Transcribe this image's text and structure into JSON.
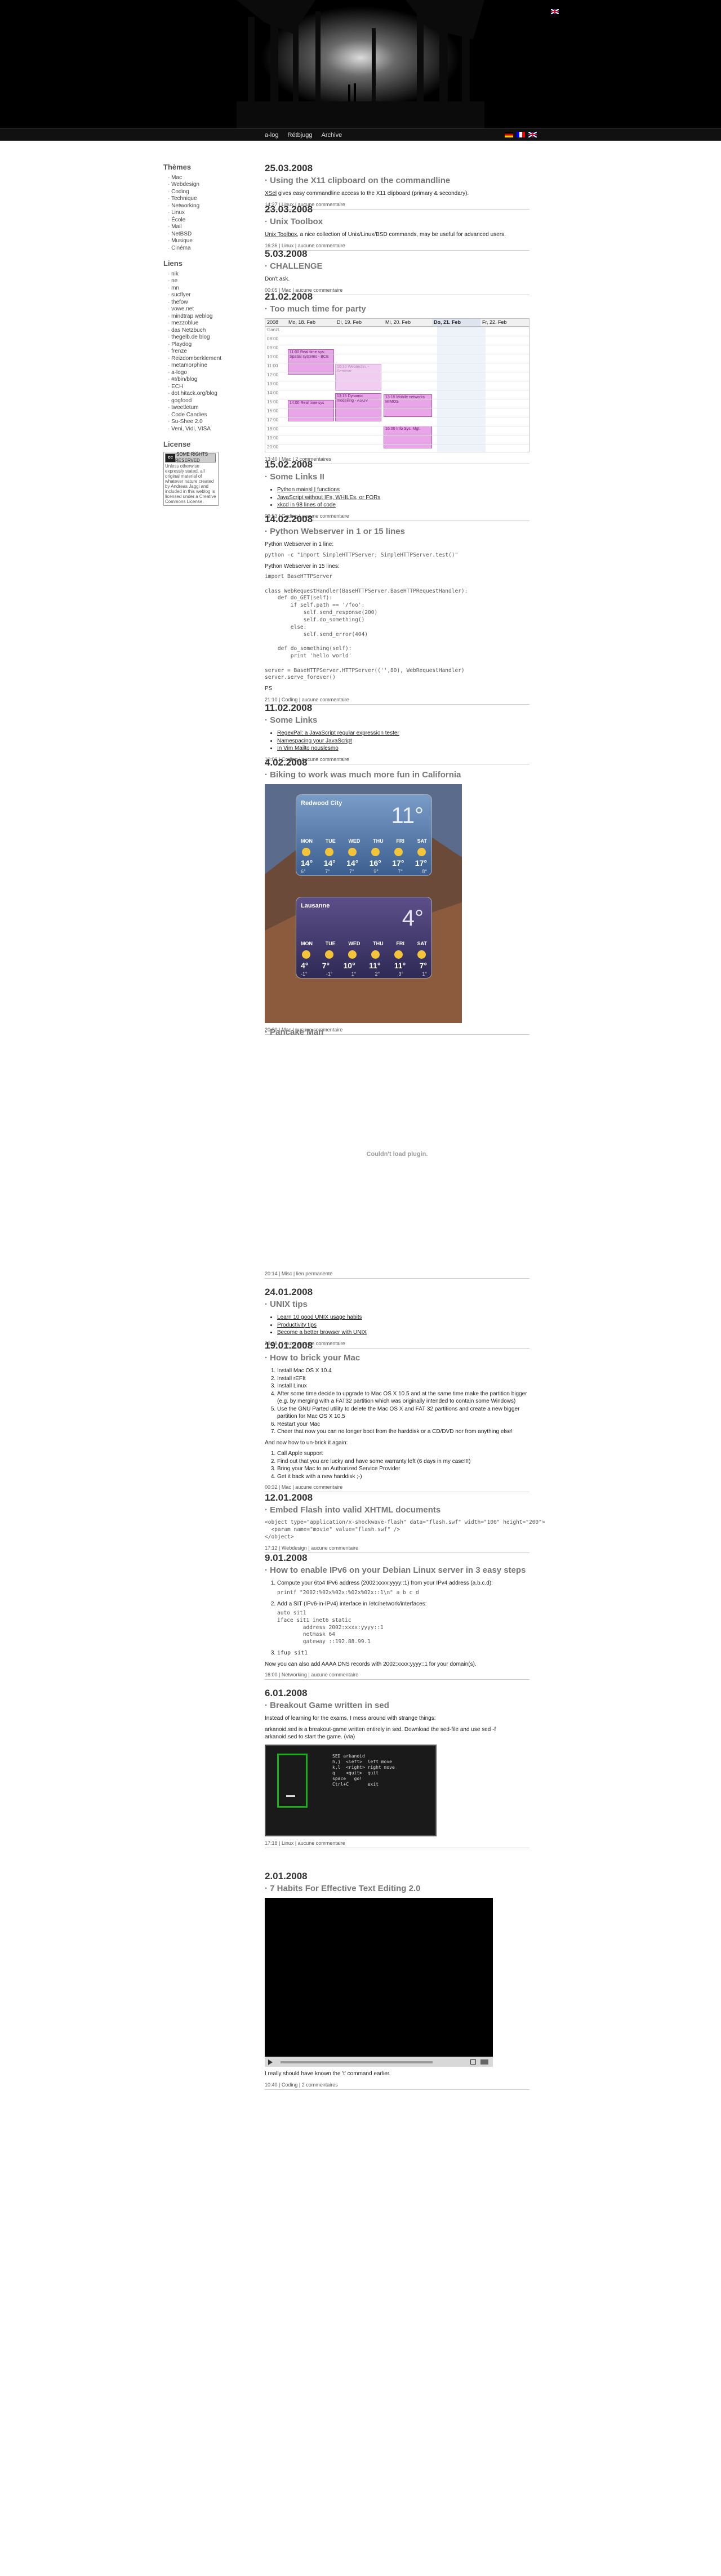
{
  "header": {
    "nav_links": [
      "a-log",
      "Rétbjugg",
      "Archive"
    ]
  },
  "sidebar": {
    "themes_heading": "Thèmes",
    "themes": [
      "Mac",
      "Webdesign",
      "Coding",
      "Technique",
      "Networking",
      "Linux",
      "École",
      "Mail",
      "NetBSD",
      "Musique",
      "Cinéma"
    ],
    "links_heading": "Liens",
    "links": [
      "nik",
      "ne",
      "mn",
      "sucflyer",
      "thefow",
      "vowe.net",
      "mindtrap weblog",
      "mezzoblue",
      "das Netzbuch",
      "thegelb.de blog",
      "Playdog",
      "frenze",
      "Reizdomberklement",
      "metamorphine",
      "a-logo",
      "#!/bin/blog",
      "ECH",
      "dot.hitack.org/blog",
      "gogfood",
      "tweetletum",
      "Code Candies",
      "Su-Shee 2.0",
      "Veni, Vidi, VISA"
    ],
    "license_heading": "License",
    "license_text": "Unless otherwise expressly stated, all original material of whatever nature created by Andreas Jaggi and included in this weblog is licensed under a Creative Commons License."
  },
  "posts": {
    "p1": {
      "date": "25.03.2008",
      "title": "Using the X11 clipboard on the commandline",
      "link": "XSel",
      "body": " gives easy commandline access to the X11 clipboard (primary & secondary).",
      "time": "14:27",
      "category": "Linux",
      "comments": "aucune commentaire"
    },
    "p2": {
      "date": "23.03.2008",
      "title": "Unix Toolbox",
      "link": "Unix Toolbox",
      "body": ", a nice collection of Unix/Linux/BSD commands, may be useful for advanced users.",
      "time": "16:36",
      "category": "Linux",
      "comments": "aucune commentaire"
    },
    "p3": {
      "date": "5.03.2008",
      "title": "CHALLENGE",
      "body": "Don't ask.",
      "time": "00:05",
      "category": "Mac",
      "comments": "aucune commentaire"
    },
    "p4": {
      "date": "21.02.2008",
      "title": "Too much time for party",
      "time": "13:40",
      "category": "Mac",
      "comments": "2 commentaires",
      "cal_year": "2008",
      "cal_days": [
        "Mo, 18. Feb",
        "Di, 19. Feb",
        "Mi, 20. Feb",
        "Do, 21. Feb",
        "Fr, 22. Feb"
      ],
      "cal_hours": [
        "Ganzt.",
        "08:00",
        "09:00",
        "10:00",
        "11:00",
        "12:00",
        "13:00",
        "14:00",
        "15:00",
        "16:00",
        "17:00",
        "18:00",
        "19:00",
        "20:00"
      ],
      "events": [
        "11:00 Real time sys: Spatial systems - BCE",
        "14:00 Real time sys",
        "13:15 Dynamic modelling - ASOV",
        "10:30 Webtechn. - Seminar ...",
        "13:15 Mobile networks MIMOS",
        "16:00 Info Sys. Mgt."
      ]
    },
    "p5": {
      "date": "15.02.2008",
      "title": "Some Links II",
      "items": [
        "Python mainsl | functions",
        "JavaScript without IFs, WHILEs, or FORs",
        "xkcd in 98 lines of code"
      ],
      "time": "09:53",
      "category": "Coding",
      "comments": "aucune commentaire"
    },
    "p6": {
      "date": "14.02.2008",
      "title": "Python Webserver in 1 or 15 lines",
      "intro1": "Python Webserver in 1 line:",
      "code1": "python -c \"import SimpleHTTPServer; SimpleHTTPServer.test()\"",
      "intro2": "Python Webserver in 15 lines:",
      "code2": "import BaseHTTPServer\n\nclass WebRequestHandler(BaseHTTPServer.BaseHTTPRequestHandler):\n    def do_GET(self):\n        if self.path == '/foo':\n            self.send_response(200)\n            self.do_something()\n        else:\n            self.send_error(404)\n\n    def do_something(self):\n        print 'hello world'\n\nserver = BaseHTTPServer.HTTPServer(('',80), WebRequestHandler)\nserver.serve_forever()",
      "outro": "PS",
      "time": "21:10",
      "category": "Coding",
      "comments": "aucune commentaire"
    },
    "p7": {
      "date": "11.02.2008",
      "title": "Some Links",
      "items": [
        "RegexPal: a JavaScript regular expression tester",
        "Namespacing your JavaScript",
        "In Vim Mailto nouslesmo"
      ],
      "time": "10:00",
      "category": "Coding",
      "comments": "aucune commentaire"
    },
    "p8": {
      "date": "4.02.2008",
      "title": "Biking to work was much more fun in California",
      "w1_city": "Redwood City",
      "w1_temp": "11°",
      "w2_city": "Lausanne",
      "w2_temp": "4°",
      "days": [
        "MON",
        "TUE",
        "WED",
        "THU",
        "FRI",
        "SAT"
      ],
      "w1_hi": [
        "14°",
        "14°",
        "14°",
        "16°",
        "17°",
        "17°"
      ],
      "w1_lo": [
        "6°",
        "7°",
        "7°",
        "9°",
        "7°",
        "8°"
      ],
      "w2_hi": [
        "4°",
        "7°",
        "10°",
        "11°",
        "11°",
        "7°"
      ],
      "w2_lo": [
        "-1°",
        "-1°",
        "1°",
        "2°",
        "3°",
        "1°"
      ],
      "time": "20:30",
      "category": "Mac",
      "comments": "aucune commentaire"
    },
    "p9": {
      "title": "Pancake Man",
      "plugin": "Couldn't load plugin.",
      "time": "20:14",
      "category": "Misc",
      "comments": "lien permanente"
    },
    "p10": {
      "date": "24.01.2008",
      "title": "UNIX tips",
      "items": [
        "Learn 10 good UNIX usage habits",
        "Productivity tips",
        "Become a better browser with UNIX"
      ],
      "time": "22:28",
      "category": "Linux",
      "comments": "aucune commentaire"
    },
    "p11": {
      "date": "19.01.2008",
      "title": "How to brick your Mac",
      "steps": [
        "Install Mac OS X 10.4",
        "Install rEFIt",
        "Install Linux",
        "After some time decide to upgrade to Mac OS X 10.5 and at the same time make the partition bigger (e.g. by merging with a FAT32 partition which was originally intended to contain some Windows)",
        "Use the GNU Parted utility to delete the Mac OS X and FAT 32 partitions and create a new bigger partition for Mac OS X 10.5",
        "Restart your Mac",
        "Cheer that now you can no longer boot from the harddisk or a CD/DVD nor from anything else!"
      ],
      "unbrick_intro": "And now how to un-brick it again:",
      "unbrick": [
        "Call Apple support",
        "Find out that you are lucky and have some warranty left (6 days in my case!!!)",
        "Bring your Mac to an Authorized Service Provider",
        "Get it back with a new harddisk ;-)"
      ],
      "time": "00:32",
      "category": "Mac",
      "comments": "aucune commentaire"
    },
    "p12": {
      "date": "12.01.2008",
      "title": "Embed Flash into valid XHTML documents",
      "code": "<object type=\"application/x-shockwave-flash\" data=\"flash.swf\" width=\"100\" height=\"200\">\n  <param name=\"movie\" value=\"flash.swf\" />\n</object>",
      "time": "17:12",
      "category": "Webdesign",
      "comments": "aucune commentaire"
    },
    "p13": {
      "date": "9.01.2008",
      "title": "How to enable IPv6 on your Debian Linux server in 3 easy steps",
      "step1": "Compute your 6to4 IPv6 address (2002:xxxx:yyyy::1) from your IPv4 address (a.b.c.d):",
      "code1": "printf \"2002:%02x%02x:%02x%02x::1\\n\" a b c d",
      "step2": "Add a SIT (IPv6-in-IPv4) interface in /etc/network/interfaces:",
      "code2": "auto sit1\niface sit1 inet6 static\n        address 2002:xxxx:yyyy::1\n        netmask 64\n        gateway ::192.88.99.1",
      "step3": "ifup sit1",
      "note": "Now you can also add AAAA DNS records with 2002:xxxx:yyyy::1 for your domain(s).",
      "time": "16:00",
      "category": "Networking",
      "comments": "aucune commentaire"
    },
    "p14": {
      "date": "6.01.2008",
      "title": "Breakout Game written in sed",
      "p1": "Instead of learning for the exams, I mess around with strange things:",
      "p2": "arkanoid.sed is a breakout-game written entirely in sed. Download the sed-file and use sed -f arkanoid.sed to start the game. (via)",
      "game_lines": [
        "SED arkanoid",
        "h,j  <left>  left move",
        "k,l  <right> right move",
        "q    <quit>  quit",
        "space   go!",
        "Ctrl+C       exit"
      ],
      "time": "17:18",
      "category": "Linux",
      "comments": "aucune commentaire"
    },
    "p15": {
      "date": "2.01.2008",
      "title": "7 Habits For Effective Text Editing 2.0",
      "body": "I really should have known the 't' command earlier.",
      "time": "10:40",
      "category": "Coding",
      "comments": "2 commentaires"
    }
  }
}
